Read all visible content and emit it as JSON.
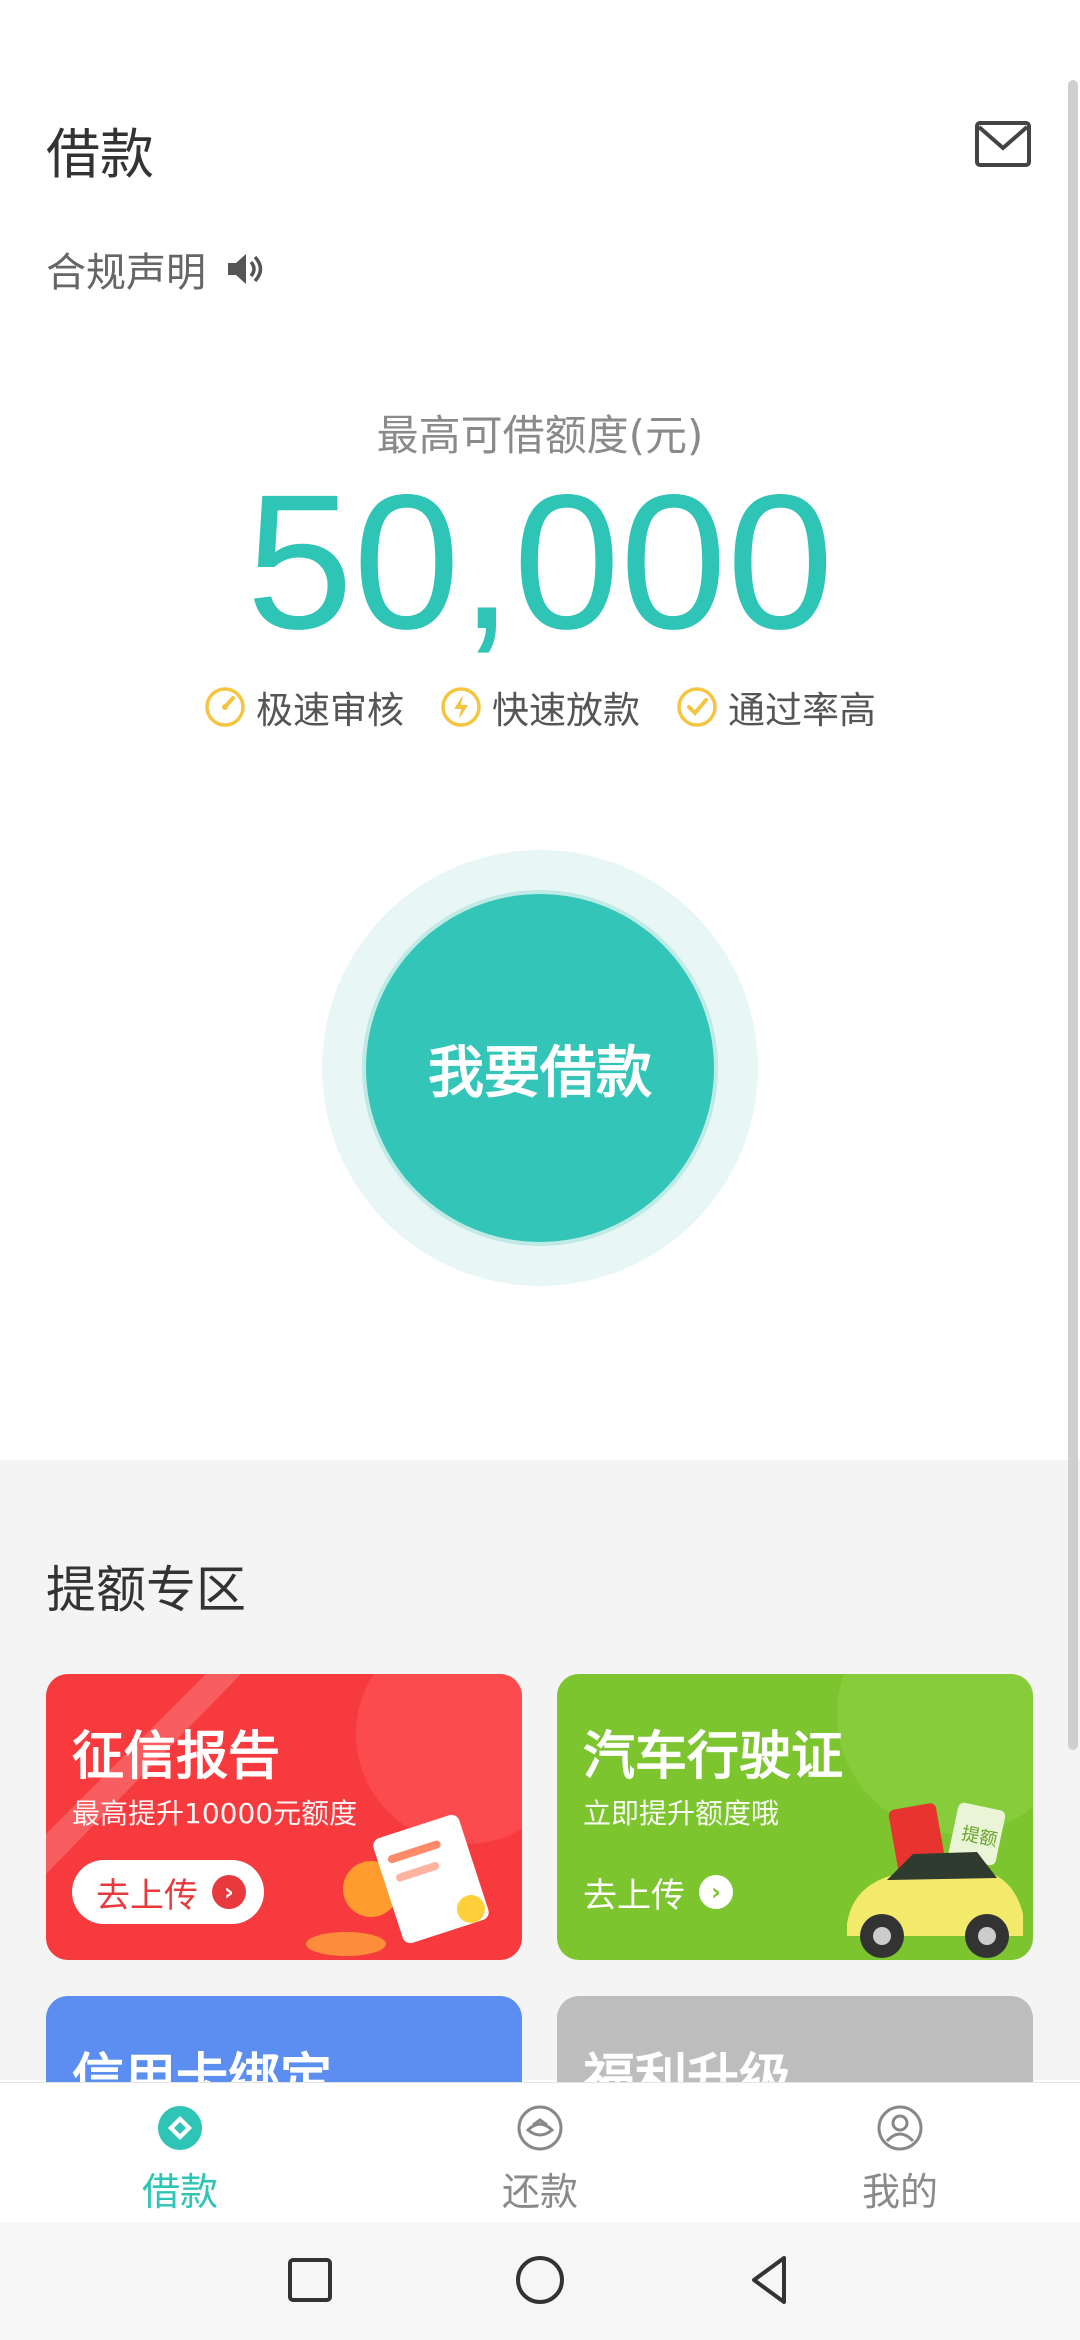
{
  "header": {
    "title": "借款",
    "compliance_label": "合规声明"
  },
  "limit": {
    "caption": "最高可借额度(元)",
    "amount": "50,000",
    "features": [
      "极速审核",
      "快速放款",
      "通过率高"
    ]
  },
  "borrow_button": "我要借款",
  "zone": {
    "title": "提额专区",
    "cards": [
      {
        "title": "征信报告",
        "subtitle": "最高提升10000元额度",
        "cta": "去上传"
      },
      {
        "title": "汽车行驶证",
        "subtitle": "立即提升额度哦",
        "cta": "去上传",
        "badge": "提额"
      },
      {
        "title": "信用卡绑定"
      },
      {
        "title": "福利升级"
      }
    ]
  },
  "tabs": [
    {
      "label": "借款",
      "active": true
    },
    {
      "label": "还款",
      "active": false
    },
    {
      "label": "我的",
      "active": false
    }
  ],
  "colors": {
    "accent": "#2ec4b6",
    "credit_card": "#f73a3d",
    "car_card": "#7cc52f",
    "blue_card": "#5b8ef0",
    "grey_card": "#bdbdbd"
  }
}
